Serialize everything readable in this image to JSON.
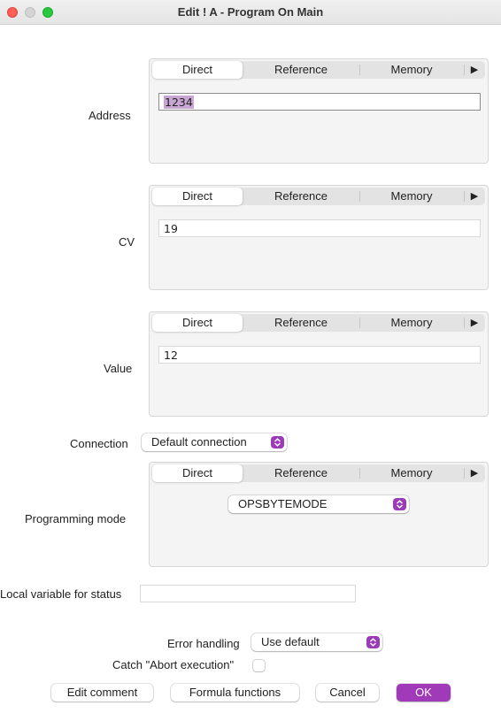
{
  "window": {
    "title": "Edit ! A - Program On Main"
  },
  "tabs": {
    "direct": "Direct",
    "reference": "Reference",
    "memory": "Memory",
    "more": "▶"
  },
  "address": {
    "label": "Address",
    "value": "1234"
  },
  "cv": {
    "label": "CV",
    "value": "19"
  },
  "value": {
    "label": "Value",
    "value": "12"
  },
  "connection": {
    "label": "Connection",
    "selected": "Default connection"
  },
  "programming_mode": {
    "label": "Programming mode",
    "selected": "OPSBYTEMODE"
  },
  "local_variable": {
    "label": "Local variable for status",
    "value": ""
  },
  "error_handling": {
    "label": "Error handling",
    "selected": "Use default"
  },
  "catch_abort": {
    "label": "Catch \"Abort execution\"",
    "checked": false
  },
  "buttons": {
    "edit_comment": "Edit comment",
    "formula_functions": "Formula functions",
    "cancel": "Cancel",
    "ok": "OK"
  },
  "colors": {
    "accent": "#a13ab8",
    "selection": "#c7a6d3"
  }
}
